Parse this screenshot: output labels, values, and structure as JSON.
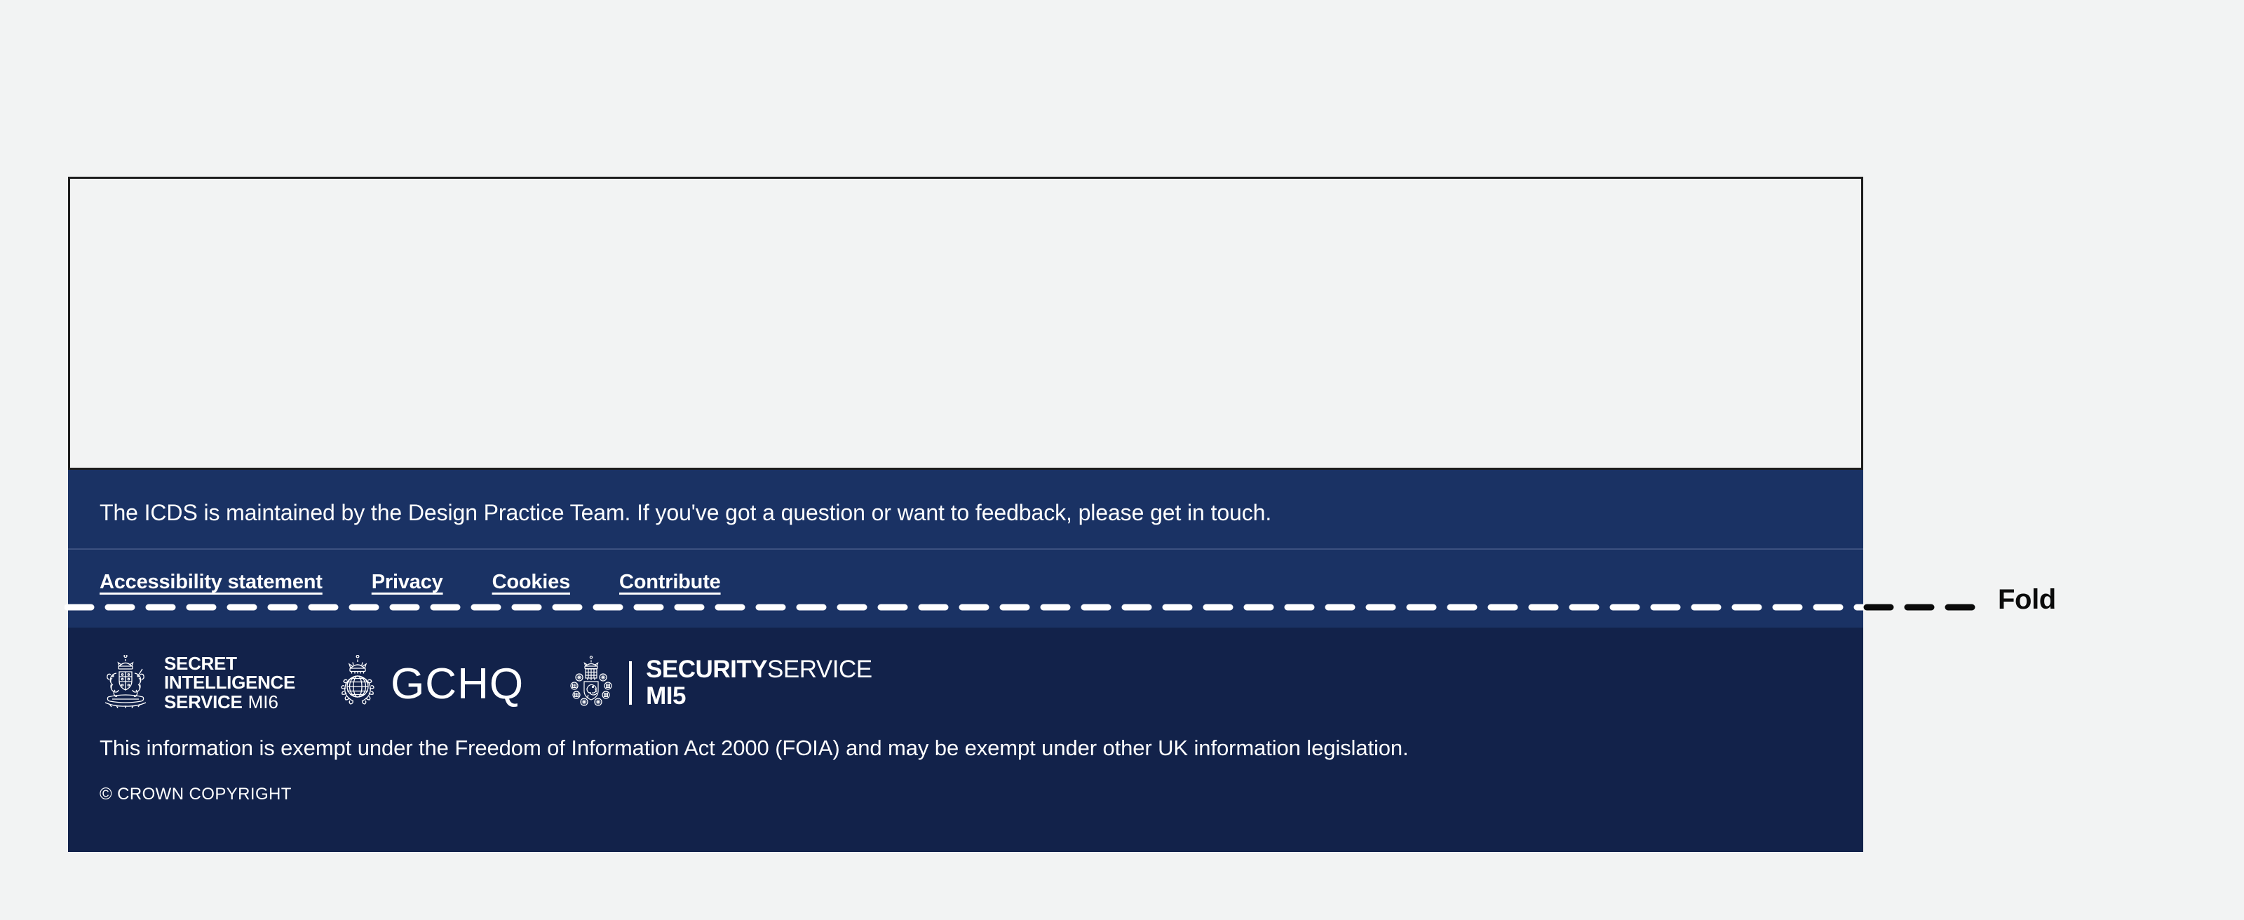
{
  "page": {
    "background_color": "#f2f3f3",
    "fold_marker_label": "Fold"
  },
  "content_box": {
    "name": "empty-page-body-placeholder",
    "border_color": "#1d1d1d",
    "fill_color": "#f2f3f3"
  },
  "footer": {
    "upper_background_color": "#1a3264",
    "lower_background_color": "#12224a",
    "message": "The ICDS is maintained by the Design Practice Team. If you've got a question or want to feedback, please get in touch.",
    "links": [
      {
        "label": "Accessibility statement"
      },
      {
        "label": "Privacy"
      },
      {
        "label": "Cookies"
      },
      {
        "label": "Contribute"
      }
    ],
    "logos": [
      {
        "id": "sis-mi6",
        "crest": "royal-coat-of-arms-crest",
        "line1": "SECRET",
        "line2": "INTELLIGENCE",
        "line3_bold": "SERVICE",
        "line3_light": "MI6"
      },
      {
        "id": "gchq",
        "crest": "gchq-crown-globe-crest",
        "wordmark": "GCHQ"
      },
      {
        "id": "mi5",
        "crest": "mi5-security-service-crest",
        "line1_bold": "SECURITY",
        "line1_regular": "SERVICE",
        "line2": "MI5"
      }
    ],
    "foia_statement": "This information is exempt under the Freedom of Information Act 2000 (FOIA) and may be exempt under other UK information legislation.",
    "copyright": "© CROWN COPYRIGHT"
  }
}
